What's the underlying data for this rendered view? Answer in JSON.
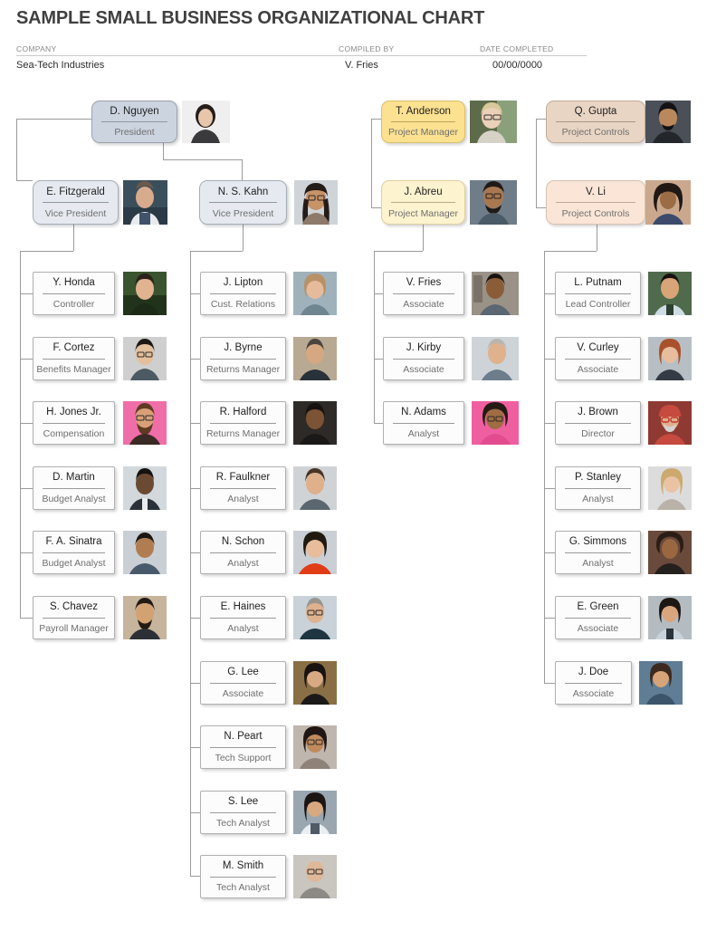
{
  "document": {
    "title": "SAMPLE SMALL BUSINESS ORGANIZATIONAL CHART"
  },
  "meta": {
    "company_label": "COMPANY",
    "company_value": "Sea-Tech Industries",
    "compiled_by_label": "COMPILED BY",
    "compiled_by_value": "V. Fries",
    "date_completed_label": "DATE COMPLETED",
    "date_completed_value": "00/00/0000"
  },
  "colors": {
    "president": "#ccd4df",
    "vice_president": "#e6eaf0",
    "project_manager_primary": "#fbe190",
    "project_manager_secondary": "#fdf3cf",
    "project_controls_primary": "#e8d5c3",
    "project_controls_secondary": "#fae5d6",
    "staff": "#fcfcfc",
    "connector": "#9b9b9b",
    "title_text": "#404040",
    "label_text": "#8a8a8a"
  },
  "org": {
    "president": {
      "name": "D. Nguyen",
      "title": "President"
    },
    "branches": [
      {
        "head": {
          "name": "E. Fitzgerald",
          "title": "Vice President"
        },
        "reports": [
          {
            "name": "Y. Honda",
            "title": "Controller"
          },
          {
            "name": "F. Cortez",
            "title": "Benefits Manager"
          },
          {
            "name": "H. Jones Jr.",
            "title": "Compensation"
          },
          {
            "name": "D. Martin",
            "title": "Budget Analyst"
          },
          {
            "name": "F. A. Sinatra",
            "title": "Budget Analyst"
          },
          {
            "name": "S. Chavez",
            "title": "Payroll Manager"
          }
        ]
      },
      {
        "head": {
          "name": "N. S. Kahn",
          "title": "Vice President"
        },
        "reports": [
          {
            "name": "J. Lipton",
            "title": "Cust. Relations"
          },
          {
            "name": "J. Byrne",
            "title": "Returns Manager"
          },
          {
            "name": "R. Halford",
            "title": "Returns Manager"
          },
          {
            "name": "R. Faulkner",
            "title": "Analyst"
          },
          {
            "name": "N. Schon",
            "title": "Analyst"
          },
          {
            "name": "E. Haines",
            "title": "Analyst"
          },
          {
            "name": "G. Lee",
            "title": "Associate"
          },
          {
            "name": "N. Peart",
            "title": "Tech Support"
          },
          {
            "name": "S. Lee",
            "title": "Tech Analyst"
          },
          {
            "name": "M. Smith",
            "title": "Tech Analyst"
          }
        ]
      },
      {
        "top": {
          "name": "T. Anderson",
          "title": "Project Manager"
        },
        "head": {
          "name": "J. Abreu",
          "title": "Project Manager"
        },
        "reports": [
          {
            "name": "V. Fries",
            "title": "Associate"
          },
          {
            "name": "J. Kirby",
            "title": "Associate"
          },
          {
            "name": "N. Adams",
            "title": "Analyst"
          }
        ]
      },
      {
        "top": {
          "name": "Q. Gupta",
          "title": "Project Controls"
        },
        "head": {
          "name": "V. Li",
          "title": "Project Controls"
        },
        "reports": [
          {
            "name": "L. Putnam",
            "title": "Lead Controller"
          },
          {
            "name": "V. Curley",
            "title": "Associate"
          },
          {
            "name": "J. Brown",
            "title": "Director"
          },
          {
            "name": "P. Stanley",
            "title": "Analyst"
          },
          {
            "name": "G. Simmons",
            "title": "Analyst"
          },
          {
            "name": "E. Green",
            "title": "Associate"
          },
          {
            "name": "J. Doe",
            "title": "Associate"
          }
        ]
      }
    ]
  },
  "photos": {
    "president": {
      "name": "photo-d-nguyen",
      "a": "#efefef",
      "b": "#3a3a3c",
      "skin": "#e8c6ab",
      "hair": "#241d1a"
    },
    "e_fitzgerald": {
      "name": "photo-e-fitzgerald",
      "a": "#3b4e5c",
      "b": "#2a3a46",
      "skin": "#d8ab8c",
      "hair": "#6d5a4c"
    },
    "n_s_kahn": {
      "name": "photo-n-s-kahn",
      "a": "#cfd4d8",
      "b": "#8d7a6a",
      "skin": "#c89367",
      "hair": "#241c18"
    },
    "t_anderson": {
      "name": "photo-t-anderson",
      "a": "#5e6b4a",
      "b": "#d6d2c6",
      "skin": "#ecd0b8",
      "hair": "#d8c89a"
    },
    "j_abreu": {
      "name": "photo-j-abreu",
      "a": "#6f7d89",
      "b": "#4a5a66",
      "skin": "#a9784f",
      "hair": "#201a16"
    },
    "q_gupta": {
      "name": "photo-q-gupta",
      "a": "#4b4f57",
      "b": "#23262b",
      "skin": "#b9885c",
      "hair": "#131214"
    },
    "v_li": {
      "name": "photo-v-li",
      "a": "#caa88e",
      "b": "#3c4b6b",
      "skin": "#9c6c44",
      "hair": "#201815"
    },
    "y_honda": {
      "name": "photo-y-honda",
      "a": "#39542f",
      "b": "#22331c",
      "skin": "#e2b391",
      "hair": "#2b211a"
    },
    "f_cortez": {
      "name": "photo-f-cortez",
      "a": "#cfcfcf",
      "b": "#4c5a63",
      "skin": "#e4bf9c",
      "hair": "#1d1815"
    },
    "h_jones_jr": {
      "name": "photo-h-jones-jr",
      "a": "#f06ea8",
      "b": "#e9538f",
      "skin": "#d9a077",
      "hair": "#5e3a22"
    },
    "d_martin": {
      "name": "photo-d-martin",
      "a": "#d2d8dc",
      "b": "#2b3138",
      "skin": "#6b4a32",
      "hair": "#151211"
    },
    "f_a_sinatra": {
      "name": "photo-f-a-sinatra",
      "a": "#c9cfd4",
      "b": "#48596b",
      "skin": "#b07c52",
      "hair": "#1c1512"
    },
    "s_chavez": {
      "name": "photo-s-chavez",
      "a": "#c6b49c",
      "b": "#2c2f35",
      "skin": "#d3a273",
      "hair": "#221a14"
    },
    "j_lipton": {
      "name": "photo-j-lipton",
      "a": "#9fb2bc",
      "b": "#6f8590",
      "skin": "#e5bb9b",
      "hair": "#b99167"
    },
    "j_byrne": {
      "name": "photo-j-byrne",
      "a": "#b7a992",
      "b": "#29313a",
      "skin": "#d6a881",
      "hair": "#4c4440"
    },
    "r_halford": {
      "name": "photo-r-halford",
      "a": "#2e2a27",
      "b": "#1b1917",
      "skin": "#7c5334",
      "hair": "#17120f"
    },
    "r_faulkner": {
      "name": "photo-r-faulkner",
      "a": "#cfd3d6",
      "b": "#5a6770",
      "skin": "#dfb08a",
      "hair": "#4a3425"
    },
    "n_schon": {
      "name": "photo-n-schon",
      "a": "#c9cfd4",
      "b": "#e03d17",
      "skin": "#e8bd9b",
      "hair": "#20190f"
    },
    "e_haines": {
      "name": "photo-e-haines",
      "a": "#c8d2d8",
      "b": "#1f3542",
      "skin": "#dfb28e",
      "hair": "#9a9490"
    },
    "g_lee": {
      "name": "photo-g-lee",
      "a": "#8a6f46",
      "b": "#1c1a19",
      "skin": "#d8aa84",
      "hair": "#181311"
    },
    "n_peart": {
      "name": "photo-n-peart",
      "a": "#bfb6ae",
      "b": "#8f8379",
      "skin": "#c08a5c",
      "hair": "#201715"
    },
    "s_lee": {
      "name": "photo-s-lee",
      "a": "#9aa6b0",
      "b": "#4e5a66",
      "skin": "#d8a87f",
      "hair": "#1c1513"
    },
    "m_smith": {
      "name": "photo-m-smith",
      "a": "#c9c5bf",
      "b": "#8d8a85",
      "skin": "#dfb899",
      "hair": "#cbc7c2"
    },
    "v_fries": {
      "name": "photo-v-fries",
      "a": "#9a9287",
      "b": "#5b6773",
      "skin": "#8a5c38",
      "hair": "#191310"
    },
    "j_kirby": {
      "name": "photo-j-kirby",
      "a": "#cdd3d7",
      "b": "#6d7d8c",
      "skin": "#dfb18c",
      "hair": "#b9b5b0"
    },
    "n_adams": {
      "name": "photo-n-adams",
      "a": "#ef5fa0",
      "b": "#e34b90",
      "skin": "#a06c43",
      "hair": "#241a14"
    },
    "l_putnam": {
      "name": "photo-l-putnam",
      "a": "#4f6b4c",
      "b": "#2e4130",
      "skin": "#d9a478",
      "hair": "#17120f"
    },
    "v_curley": {
      "name": "photo-v-curley",
      "a": "#b8bfc4",
      "b": "#333b44",
      "skin": "#e8bd9e",
      "hair": "#a8512a"
    },
    "j_brown": {
      "name": "photo-j-brown",
      "a": "#8e3a33",
      "b": "#c64a3e",
      "skin": "#dfae8c",
      "hair": "#d6d2cd"
    },
    "p_stanley": {
      "name": "photo-p-stanley",
      "a": "#dcdcdc",
      "b": "#b9b2a8",
      "skin": "#e9c3a4",
      "hair": "#cba96f"
    },
    "g_simmons": {
      "name": "photo-g-simmons",
      "a": "#6a4a3a",
      "b": "#24201e",
      "skin": "#9a6740",
      "hair": "#2a1d16"
    },
    "e_green": {
      "name": "photo-e-green",
      "a": "#b4bcc2",
      "b": "#2b333b",
      "skin": "#d9a57c",
      "hair": "#1d1714"
    },
    "j_doe": {
      "name": "photo-j-doe",
      "a": "#5f7d95",
      "b": "#3c556b",
      "skin": "#d6a478",
      "hair": "#3d2a1e"
    }
  }
}
